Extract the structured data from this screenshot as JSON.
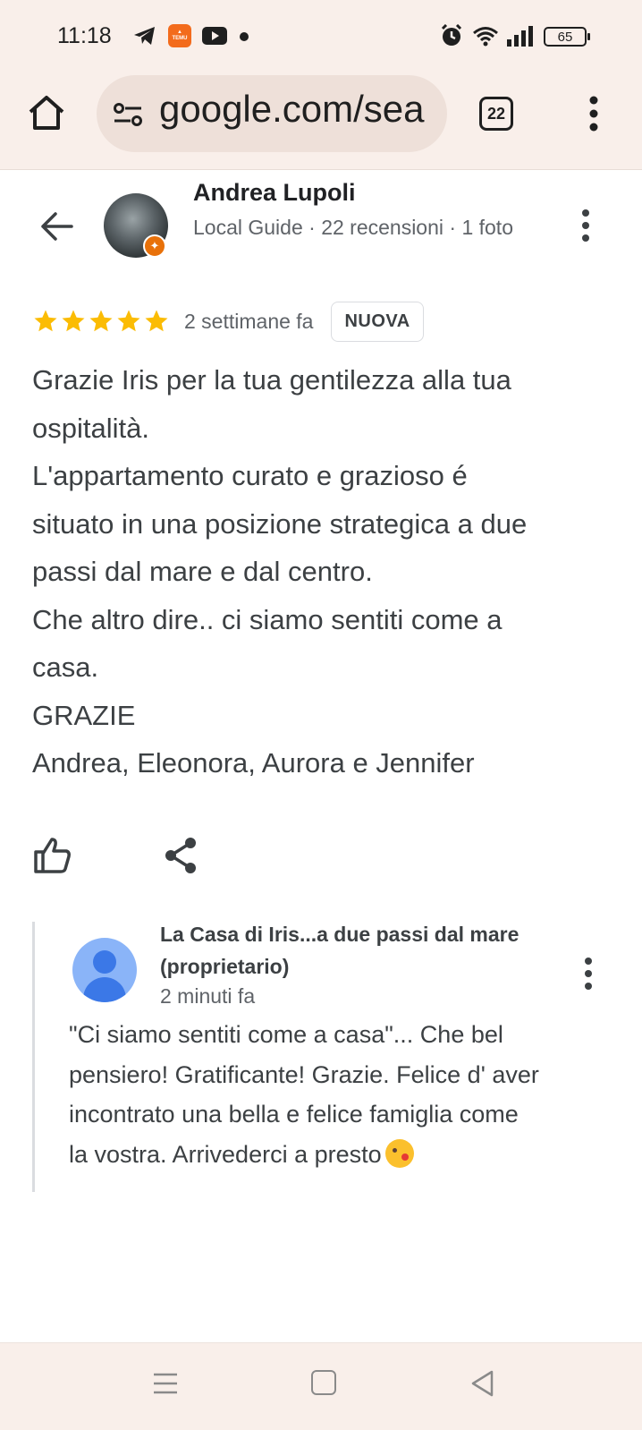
{
  "status_bar": {
    "time": "11:18",
    "battery_level": "65",
    "notification_icons": [
      "telegram-icon",
      "temu-icon",
      "youtube-icon",
      "dot"
    ],
    "system_icons": [
      "alarm-icon",
      "wifi-icon",
      "signal-icon",
      "battery-icon"
    ]
  },
  "browser": {
    "url": "google.com/sea",
    "tab_count": "22"
  },
  "review": {
    "reviewer_name": "Andrea Lupoli",
    "reviewer_meta": "Local Guide · 22 recensioni · 1 foto",
    "rating": 5,
    "date": "2 settimane fa",
    "badge": "NUOVA",
    "text_lines": [
      "Grazie Iris per la tua gentilezza alla tua",
      "ospitalità.",
      "L'appartamento curato e grazioso é",
      "situato in una posizione strategica a due",
      "passi dal mare e dal centro.",
      "Che altro dire.. ci siamo sentiti come a",
      "casa.",
      "GRAZIE",
      "Andrea, Eleonora, Aurora e Jennifer"
    ]
  },
  "reply": {
    "owner_name": "La Casa di Iris...a due passi dal mare (proprietario)",
    "date": "2 minuti fa",
    "text_lines": [
      "\"Ci siamo sentiti come a casa\"... Che bel",
      "pensiero! Gratificante! Grazie. Felice d' aver",
      "incontrato una bella e felice famiglia come",
      "la vostra. Arrivederci a presto"
    ],
    "emoji": "kissing-face-emoji"
  },
  "colors": {
    "chrome_bg": "#f9efea",
    "omnibox_bg": "#eee0d9",
    "star": "#fbbc04",
    "guide_badge": "#e8710a",
    "owner_avatar": "#8ab4f8"
  }
}
